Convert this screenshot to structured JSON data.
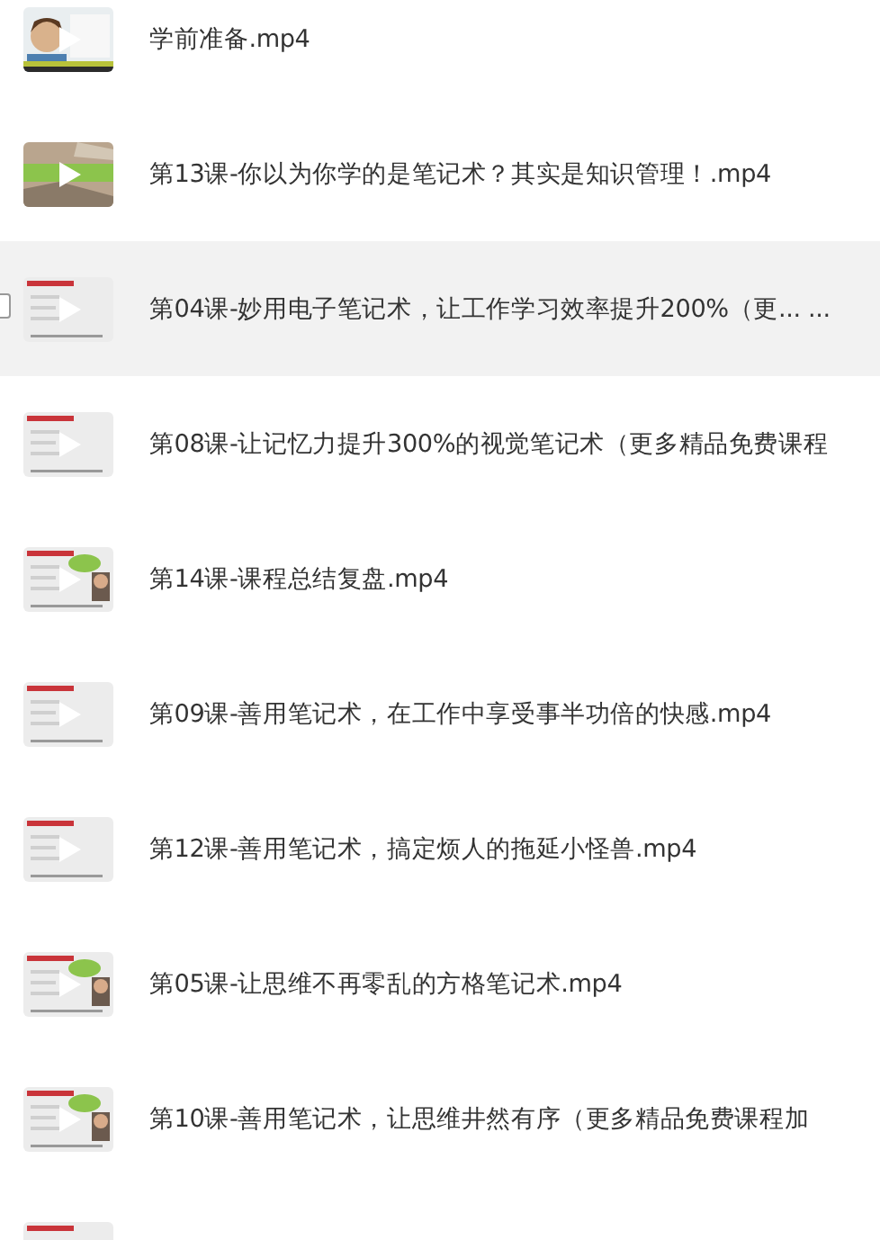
{
  "files": [
    {
      "name": "学前准备.mp4",
      "selected": false
    },
    {
      "name": "第13课-你以为你学的是笔记术？其实是知识管理！.mp4",
      "selected": false
    },
    {
      "name": "第04课-妙用电子笔记术，让工作学习效率提升200%（更... ...",
      "selected": true
    },
    {
      "name": "第08课-让记忆力提升300%的视觉笔记术（更多精品免费课程",
      "selected": false
    },
    {
      "name": "第14课-课程总结复盘.mp4",
      "selected": false
    },
    {
      "name": "第09课-善用笔记术，在工作中享受事半功倍的快感.mp4",
      "selected": false
    },
    {
      "name": "第12课-善用笔记术，搞定烦人的拖延小怪兽.mp4",
      "selected": false
    },
    {
      "name": "第05课-让思维不再零乱的方格笔记术.mp4",
      "selected": false
    },
    {
      "name": "第10课-善用笔记术，让思维井然有序（更多精品免费课程加",
      "selected": false
    },
    {
      "selected": false
    }
  ]
}
